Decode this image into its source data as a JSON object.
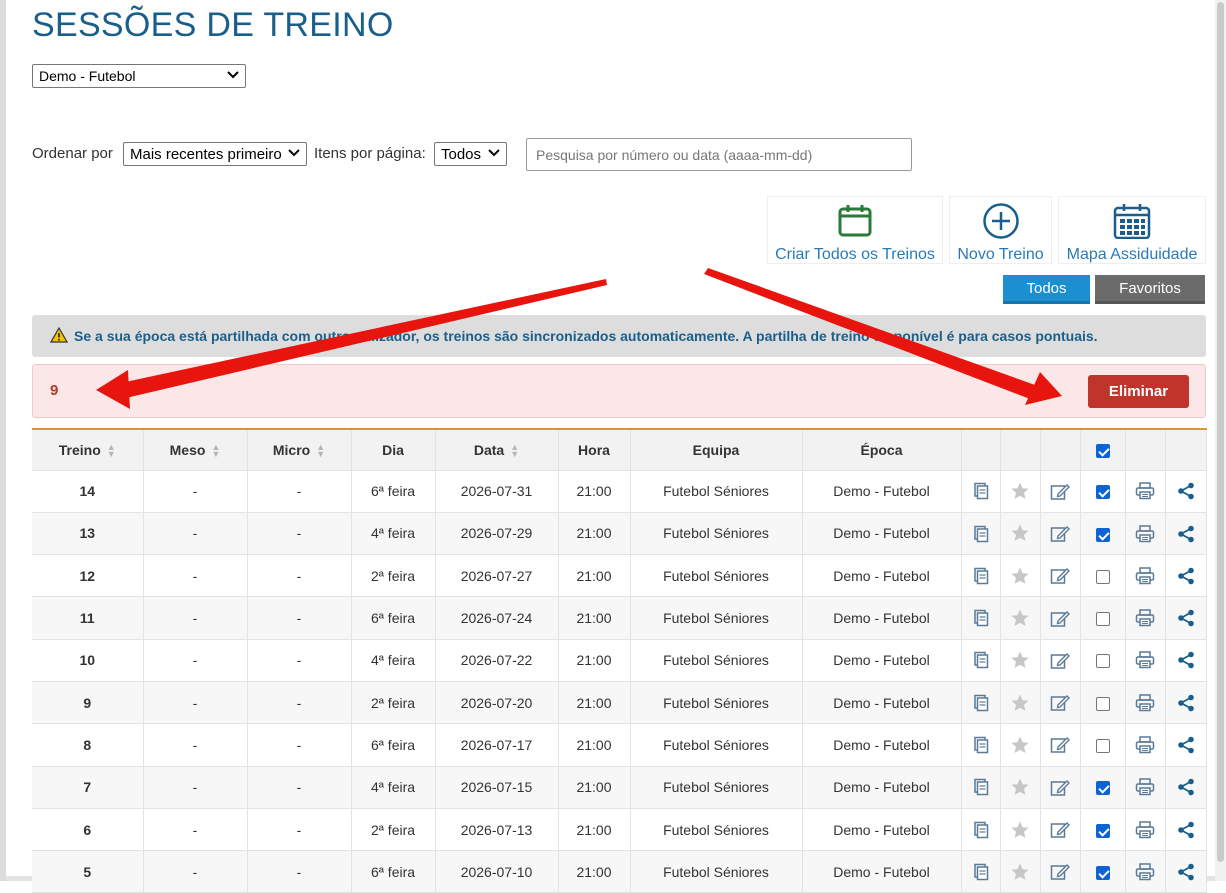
{
  "page": {
    "title": "SESSÕES DE TREINO"
  },
  "season_select": {
    "value": "Demo - Futebol"
  },
  "controls": {
    "sort_label": "Ordenar por",
    "sort_value": "Mais recentes primeiro",
    "per_page_label": "Itens por página:",
    "per_page_value": "Todos",
    "search_placeholder": "Pesquisa por número ou data (aaaa-mm-dd)"
  },
  "actions": {
    "all_sessions": "Criar Todos os Treinos",
    "new_session": "Novo Treino",
    "attendance_map": "Mapa Assiduidade"
  },
  "filters": {
    "all": "Todos",
    "favorites": "Favoritos"
  },
  "warning": {
    "text": "Se a sua época está partilhada com outro utilizador, os treinos são sincronizados automaticamente. A partilha de treino disponível é para casos pontuais."
  },
  "selection": {
    "count": "9",
    "delete_label": "Eliminar"
  },
  "table": {
    "headers": {
      "session": "Treino",
      "meso": "Meso",
      "micro": "Micro",
      "day": "Dia",
      "date": "Data",
      "time": "Hora",
      "team": "Equipa",
      "season": "Época"
    },
    "header_checkbox_checked": true,
    "rows": [
      {
        "num": "14",
        "meso": "-",
        "micro": "-",
        "day": "6ª feira",
        "date": "2026-07-31",
        "time": "21:00",
        "team": "Futebol Séniores",
        "season": "Demo - Futebol",
        "checked": true
      },
      {
        "num": "13",
        "meso": "-",
        "micro": "-",
        "day": "4ª feira",
        "date": "2026-07-29",
        "time": "21:00",
        "team": "Futebol Séniores",
        "season": "Demo - Futebol",
        "checked": true
      },
      {
        "num": "12",
        "meso": "-",
        "micro": "-",
        "day": "2ª feira",
        "date": "2026-07-27",
        "time": "21:00",
        "team": "Futebol Séniores",
        "season": "Demo - Futebol",
        "checked": false
      },
      {
        "num": "11",
        "meso": "-",
        "micro": "-",
        "day": "6ª feira",
        "date": "2026-07-24",
        "time": "21:00",
        "team": "Futebol Séniores",
        "season": "Demo - Futebol",
        "checked": false
      },
      {
        "num": "10",
        "meso": "-",
        "micro": "-",
        "day": "4ª feira",
        "date": "2026-07-22",
        "time": "21:00",
        "team": "Futebol Séniores",
        "season": "Demo - Futebol",
        "checked": false
      },
      {
        "num": "9",
        "meso": "-",
        "micro": "-",
        "day": "2ª feira",
        "date": "2026-07-20",
        "time": "21:00",
        "team": "Futebol Séniores",
        "season": "Demo - Futebol",
        "checked": false
      },
      {
        "num": "8",
        "meso": "-",
        "micro": "-",
        "day": "6ª feira",
        "date": "2026-07-17",
        "time": "21:00",
        "team": "Futebol Séniores",
        "season": "Demo - Futebol",
        "checked": false
      },
      {
        "num": "7",
        "meso": "-",
        "micro": "-",
        "day": "4ª feira",
        "date": "2026-07-15",
        "time": "21:00",
        "team": "Futebol Séniores",
        "season": "Demo - Futebol",
        "checked": true
      },
      {
        "num": "6",
        "meso": "-",
        "micro": "-",
        "day": "2ª feira",
        "date": "2026-07-13",
        "time": "21:00",
        "team": "Futebol Séniores",
        "season": "Demo - Futebol",
        "checked": true
      },
      {
        "num": "5",
        "meso": "-",
        "micro": "-",
        "day": "6ª feira",
        "date": "2026-07-10",
        "time": "21:00",
        "team": "Futebol Séniores",
        "season": "Demo - Futebol",
        "checked": true
      }
    ]
  },
  "icons": {
    "calendar": "calendar-icon",
    "plus": "plus-circle-icon",
    "attendance": "attendance-grid-icon",
    "warning": "warning-icon",
    "copy": "copy-icon",
    "star": "star-icon",
    "edit": "edit-icon",
    "print": "print-icon",
    "share": "share-icon",
    "sort": "sort-icon",
    "chevron": "chevron-down-icon",
    "arrow": "red-arrow-icon"
  },
  "colors": {
    "title": "#1a5f8c",
    "link": "#2a7ab8",
    "accent_green": "#2a7a3a",
    "tab_active": "#1c8fd0",
    "tab_inactive": "#6b6b6b",
    "danger": "#c0352b",
    "danger_bg": "#fbe7e7",
    "header_border": "#e0913a",
    "annotation_arrow": "#e8150f"
  }
}
